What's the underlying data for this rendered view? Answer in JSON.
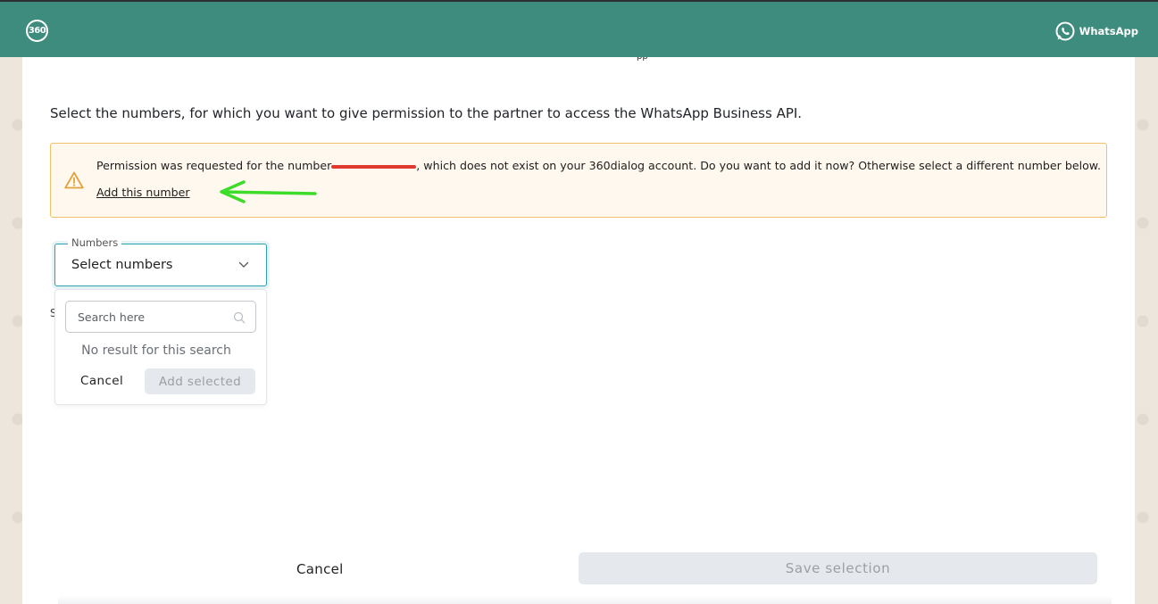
{
  "header": {
    "logo_text": "360",
    "whatsapp_label": "WhatsApp",
    "bg_color": "#3e8c7d"
  },
  "main": {
    "intro": "Select the numbers, for which you want to give permission to the partner to access the WhatsApp Business API.",
    "alert": {
      "text_before": "Permission was requested for the number",
      "text_after": ", which does not exist on your 360dialog account. Do you want to add it now? Otherwise select a different number below.",
      "link_label": "Add this number",
      "icon": "warning-icon",
      "annotation": "green-arrow"
    },
    "numbers_field": {
      "legend": "Numbers",
      "value": "Select numbers",
      "icon": "chevron-down-icon"
    },
    "hidden_letter": "S",
    "dropdown": {
      "search_placeholder": "Search here",
      "no_result": "No result for this search",
      "cancel_label": "Cancel",
      "add_label": "Add selected"
    }
  },
  "footer": {
    "cancel_label": "Cancel",
    "save_label": "Save selection"
  }
}
